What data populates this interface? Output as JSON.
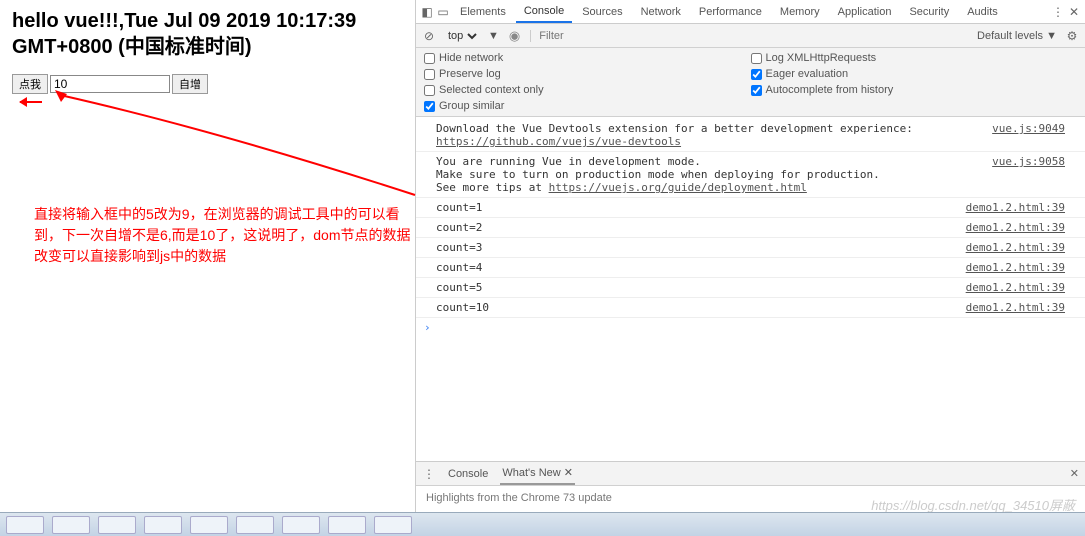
{
  "page": {
    "heading": "hello vue!!!,Tue Jul 09 2019 10:17:39 GMT+0800 (中国标准时间)",
    "button_click_label": "点我",
    "input_value": "10",
    "button_auto_label": "自增"
  },
  "annotation": {
    "text": "直接将输入框中的5改为9，在浏览器的调试工具中的可以看到，下一次自增不是6,而是10了，这说明了，dom节点的数据改变可以直接影响到js中的数据"
  },
  "devtools": {
    "tabs": [
      "Elements",
      "Console",
      "Sources",
      "Network",
      "Performance",
      "Memory",
      "Application",
      "Security",
      "Audits"
    ],
    "active_tab": "Console",
    "toolbar": {
      "context": "top",
      "filter_placeholder": "Filter",
      "levels": "Default levels ▼"
    },
    "options": {
      "hide_network": "Hide network",
      "preserve_log": "Preserve log",
      "selected_context": "Selected context only",
      "group_similar": "Group similar",
      "log_xhr": "Log XMLHttpRequests",
      "eager_eval": "Eager evaluation",
      "autocomplete": "Autocomplete from history"
    },
    "logs": [
      {
        "text": "Download the Vue Devtools extension for a better development experience:",
        "link": "https://github.com/vuejs/vue-devtools",
        "src": "vue.js:9049"
      },
      {
        "text": "You are running Vue in development mode.\nMake sure to turn on production mode when deploying for production.\nSee more tips at ",
        "link": "https://vuejs.org/guide/deployment.html",
        "src": "vue.js:9058"
      },
      {
        "text": "count=1",
        "src": "demo1.2.html:39"
      },
      {
        "text": "count=2",
        "src": "demo1.2.html:39"
      },
      {
        "text": "count=3",
        "src": "demo1.2.html:39"
      },
      {
        "text": "count=4",
        "src": "demo1.2.html:39"
      },
      {
        "text": "count=5",
        "src": "demo1.2.html:39"
      },
      {
        "text": "count=10",
        "src": "demo1.2.html:39"
      }
    ],
    "drawer": {
      "tab_console": "Console",
      "tab_whatsnew": "What's New",
      "highlight": "Highlights from the Chrome 73 update"
    }
  },
  "watermark": "https://blog.csdn.net/qq_34510屏蔽"
}
